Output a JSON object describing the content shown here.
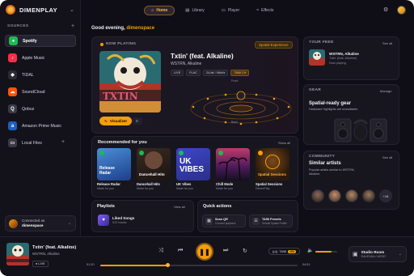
{
  "app": {
    "name": "DIMENPLAY"
  },
  "nav": {
    "tabs": [
      {
        "label": "Home",
        "icon": "home-icon"
      },
      {
        "label": "Library",
        "icon": "library-icon"
      },
      {
        "label": "Player",
        "icon": "player-icon"
      },
      {
        "label": "Effects",
        "icon": "effects-icon"
      }
    ]
  },
  "sidebar": {
    "heading": "SOURCES",
    "sources": [
      {
        "label": "Spotify",
        "color": "#1db954",
        "glyph": "●"
      },
      {
        "label": "Apple Music",
        "color": "#fa2d48",
        "glyph": "♪"
      },
      {
        "label": "TIDAL",
        "color": "#2b2b33",
        "glyph": "◆"
      },
      {
        "label": "SoundCloud",
        "color": "#ff5500",
        "glyph": "☁"
      },
      {
        "label": "Qobuz",
        "color": "#3a3a46",
        "glyph": "Q"
      },
      {
        "label": "Amazon Prime Music",
        "color": "#1f5fbf",
        "glyph": "a"
      },
      {
        "label": "Local Files",
        "color": "#3a3a46",
        "glyph": "▭"
      }
    ],
    "connected_label": "Connected as",
    "connected_user": "dimenspace"
  },
  "greeting": {
    "prefix": "Good evening, ",
    "name": "dimenspace"
  },
  "now_playing": {
    "label": "NOW PLAYING",
    "badge": "Spatial Experience",
    "title": "Txtin' (feat. Alkaline)",
    "artist": "WSTRN, Alkaline",
    "pills": [
      "LIVE",
      "FLAC",
      "24-bit / 96kHz",
      "7868 CH"
    ],
    "front": "Front",
    "back": "Back",
    "visualizer": "Visualizer"
  },
  "recommended": {
    "title": "Recommended for you",
    "show_all": "Show all",
    "items": [
      {
        "name": "Release Radar",
        "sub": "Made for you",
        "overlay": "Release Radar"
      },
      {
        "name": "Dancehall Hits",
        "sub": "Made for you",
        "overlay": "Dancehall Hits"
      },
      {
        "name": "UK Vibes",
        "sub": "Made for you",
        "overlay": "UK VIBES"
      },
      {
        "name": "Chill Mode",
        "sub": "Made for you",
        "overlay": ""
      },
      {
        "name": "Spatial Sessions",
        "sub": "DimenPlay",
        "overlay": "Spatial Sessions"
      }
    ]
  },
  "playlists": {
    "title": "Playlists",
    "view_all": "View all",
    "items": [
      {
        "name": "Liked Songs",
        "count": "512 tracks"
      }
    ]
  },
  "quick_actions": {
    "title": "Quick actions",
    "items": [
      {
        "title": "Scan QR",
        "sub": "Connect playback"
      },
      {
        "title": "TA56 Presets",
        "sub": "Default Spatial Profile"
      }
    ]
  },
  "feed": {
    "title": "YOUR FEED",
    "see_all": "See all",
    "artist": "WSTRN, Alkaline",
    "track": "Txtin' (feat. Alkaline)",
    "status": "Now playing"
  },
  "gear": {
    "title": "GEAR",
    "manage": "Manage",
    "name": "Spatial-ready gear",
    "sub": "Hardware highlights are unavailable."
  },
  "community": {
    "title": "COMMUNITY",
    "see_all": "See all",
    "name": "Similar artists",
    "sub": "Popular artists similar to WSTRN, Alkaline.",
    "more": "+18"
  },
  "player": {
    "title": "Txtin' (feat. Alkaline)",
    "artist": "WSTRN, Alkaline",
    "live": "LIVE",
    "elapsed": "01:20",
    "total": "04:01",
    "progress": 0.34,
    "tidal": "TA56",
    "tidal_on": "ON",
    "volume": 0.75,
    "device": "Studio Room",
    "device_sub": "RAVENNA / AES67"
  },
  "colors": {
    "accent": "#f59e0b",
    "bg": "#0f0e16"
  }
}
